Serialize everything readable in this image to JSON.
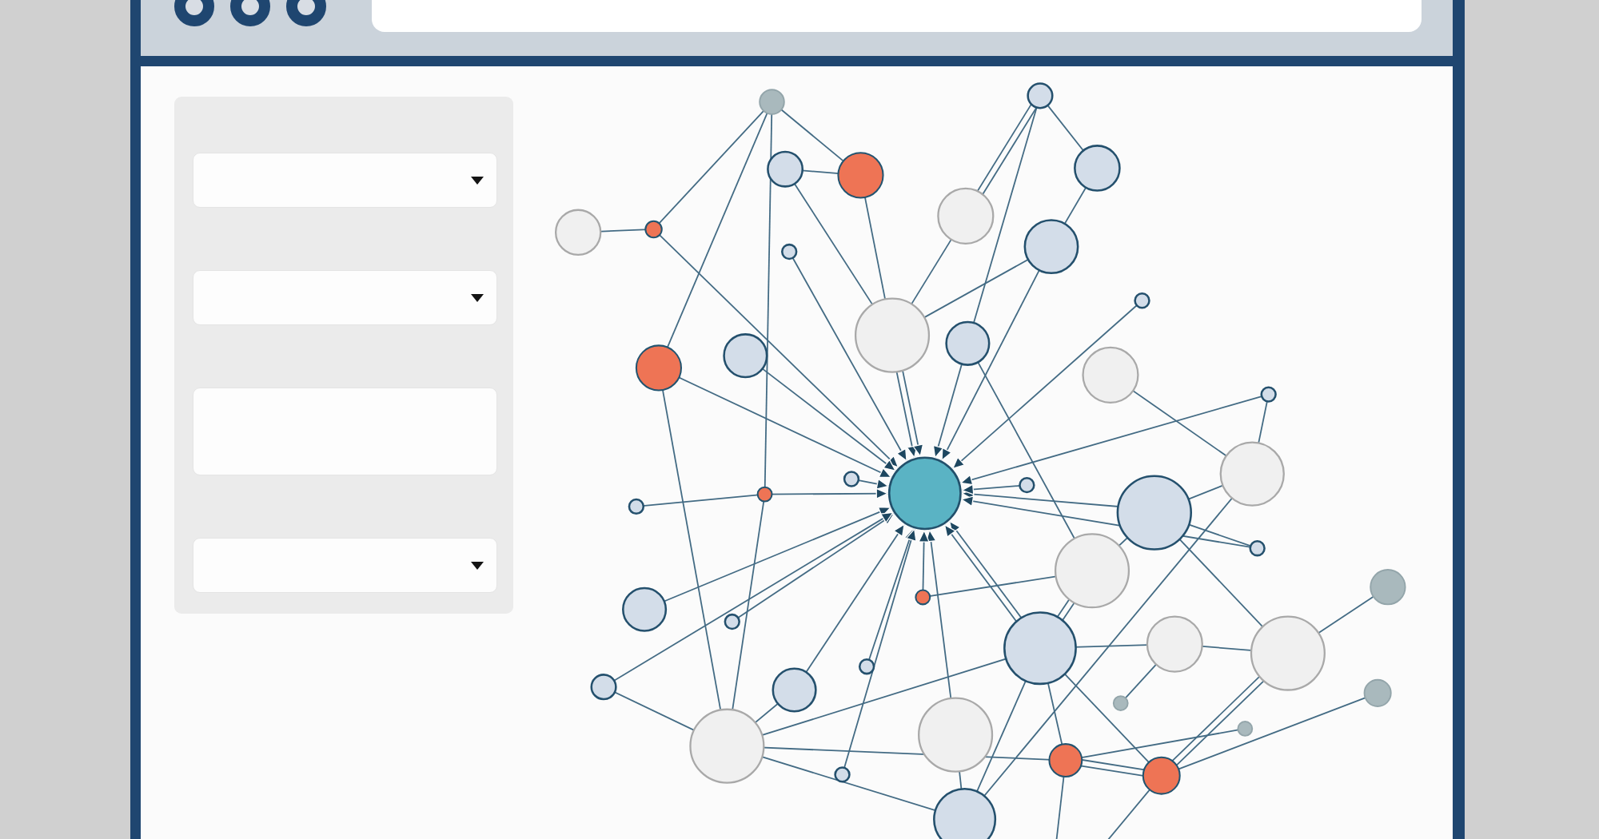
{
  "window": {
    "buttons": [
      {
        "kind": "ring"
      },
      {
        "kind": "ring"
      },
      {
        "kind": "ring"
      }
    ],
    "address_bar": {
      "kind": "url_field"
    }
  },
  "sidebar": {
    "controls": [
      {
        "kind": "dropdown"
      },
      {
        "kind": "dropdown"
      },
      {
        "kind": "text_area"
      },
      {
        "kind": "dropdown"
      }
    ]
  },
  "graph": {
    "kind": "network"
  }
}
